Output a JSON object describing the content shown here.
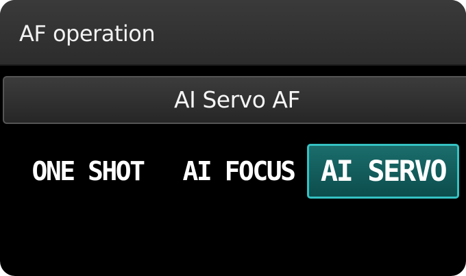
{
  "header": {
    "title": "AF operation"
  },
  "current_setting": {
    "label": "AI Servo AF"
  },
  "options": [
    {
      "label": "ONE SHOT",
      "selected": false
    },
    {
      "label": "AI FOCUS",
      "selected": false
    },
    {
      "label": "AI SERVO",
      "selected": true
    }
  ],
  "colors": {
    "background": "#000000",
    "bar": "#333333",
    "selected_fill": "#0f5a5a",
    "selected_border": "#35c2c2",
    "text": "#ffffff"
  }
}
